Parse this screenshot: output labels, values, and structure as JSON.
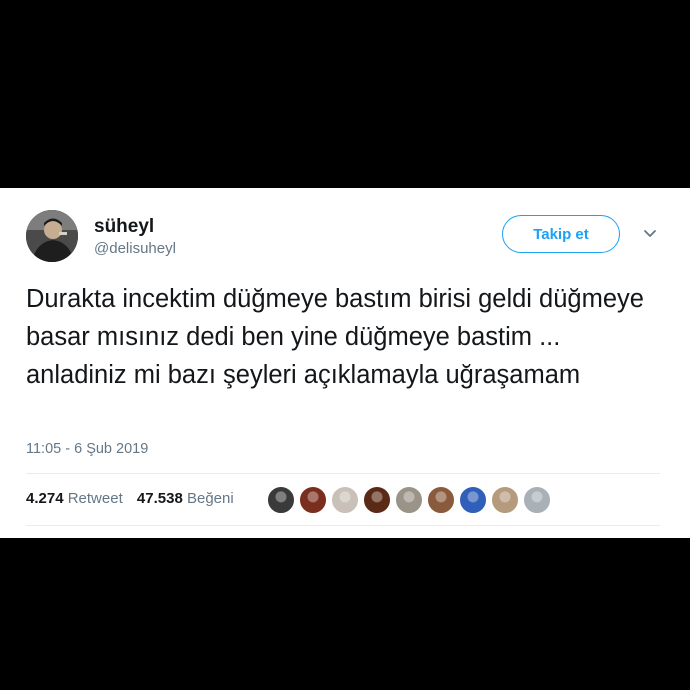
{
  "user": {
    "display_name": "süheyl",
    "handle": "@delisuheyl",
    "avatar_icon": "profile-photo-icon"
  },
  "follow_button": {
    "label": "Takip et"
  },
  "menu_icon": "chevron-down-icon",
  "tweet": {
    "text": "Durakta incektim düğmeye bastım birisi geldi düğmeye basar mısınız dedi ben yine düğmeye bastim ... anladiniz mi bazı şeyleri açıklamayla uğraşamam",
    "timestamp": "11:05 - 6 Şub 2019"
  },
  "stats": {
    "retweets_count": "4.274",
    "retweets_label": "Retweet",
    "likes_count": "47.538",
    "likes_label": "Beğeni"
  },
  "likers": [
    {
      "name": "liker-avatar-1",
      "color": "#3a3a3a"
    },
    {
      "name": "liker-avatar-2",
      "color": "#7a2e1e"
    },
    {
      "name": "liker-avatar-3",
      "color": "#c9c1b8"
    },
    {
      "name": "liker-avatar-4",
      "color": "#5b2a16"
    },
    {
      "name": "liker-avatar-5",
      "color": "#9a9488"
    },
    {
      "name": "liker-avatar-6",
      "color": "#8a5a3c"
    },
    {
      "name": "liker-avatar-7",
      "color": "#2f5fb8"
    },
    {
      "name": "liker-avatar-8",
      "color": "#b59a7e"
    },
    {
      "name": "liker-avatar-9",
      "color": "#a9b0b6"
    }
  ],
  "colors": {
    "accent": "#1da1f2",
    "text_primary": "#14171a",
    "text_secondary": "#657786",
    "background_outer": "#000000",
    "card_background": "#ffffff"
  }
}
